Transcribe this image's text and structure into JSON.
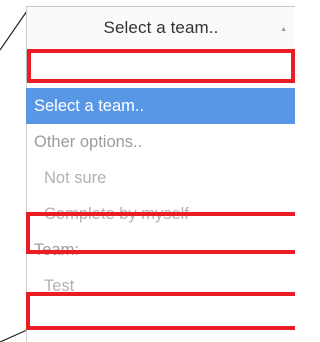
{
  "team_select": {
    "selected_value": "Select a team..",
    "arrow_icon": "caret-up-icon",
    "search": {
      "value": "",
      "placeholder": ""
    },
    "options": {
      "select_prompt": "Select a team..",
      "other_group": "Other options..",
      "not_sure": "Not sure",
      "complete_by_myself": "Complete by myself",
      "team_group": "Team:",
      "test": "Test"
    }
  },
  "colors": {
    "highlight_border": "#ea1c24",
    "selected_option_bg": "#5897e6",
    "selected_option_text": "#ffffff",
    "option_text_muted": "#b2b2b2",
    "group_label_text": "#9c9c9c",
    "select_text": "#333333"
  }
}
